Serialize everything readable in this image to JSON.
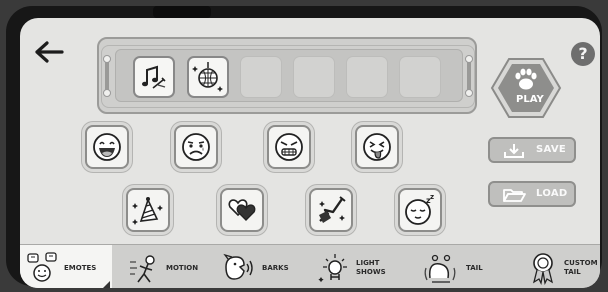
{
  "header": {
    "back_icon": "arrow-left-icon",
    "help_label": "?"
  },
  "sequence": {
    "slots": [
      {
        "filled": true,
        "icon": "music-note-icon"
      },
      {
        "filled": true,
        "icon": "disco-ball-icon"
      },
      {
        "filled": false
      },
      {
        "filled": false
      },
      {
        "filled": false
      },
      {
        "filled": false
      }
    ]
  },
  "play": {
    "label": "PLAY",
    "icon": "paw-icon"
  },
  "emotes": [
    {
      "name": "laughing-emoji-icon"
    },
    {
      "name": "sad-emoji-icon"
    },
    {
      "name": "angry-emoji-icon"
    },
    {
      "name": "tongue-out-emoji-icon"
    },
    {
      "name": "party-hat-icon"
    },
    {
      "name": "hearts-icon"
    },
    {
      "name": "guitar-icon"
    },
    {
      "name": "sleeping-emoji-icon"
    }
  ],
  "actions": {
    "save_label": "SAVE",
    "load_label": "LOAD"
  },
  "tabs": [
    {
      "label": "EMOTES",
      "active": true
    },
    {
      "label": "MOTION",
      "active": false
    },
    {
      "label": "BARKS",
      "active": false
    },
    {
      "label_line1": "LIGHT",
      "label_line2": "SHOWS",
      "active": false
    },
    {
      "label": "TAIL",
      "active": false
    },
    {
      "label_line1": "CUSTOM",
      "label_line2": "TAIL",
      "active": false
    }
  ],
  "colors": {
    "screen_bg": "#e4e4e2",
    "accent_gray": "#8a8a88",
    "active_tab": "#f5f5f3"
  }
}
